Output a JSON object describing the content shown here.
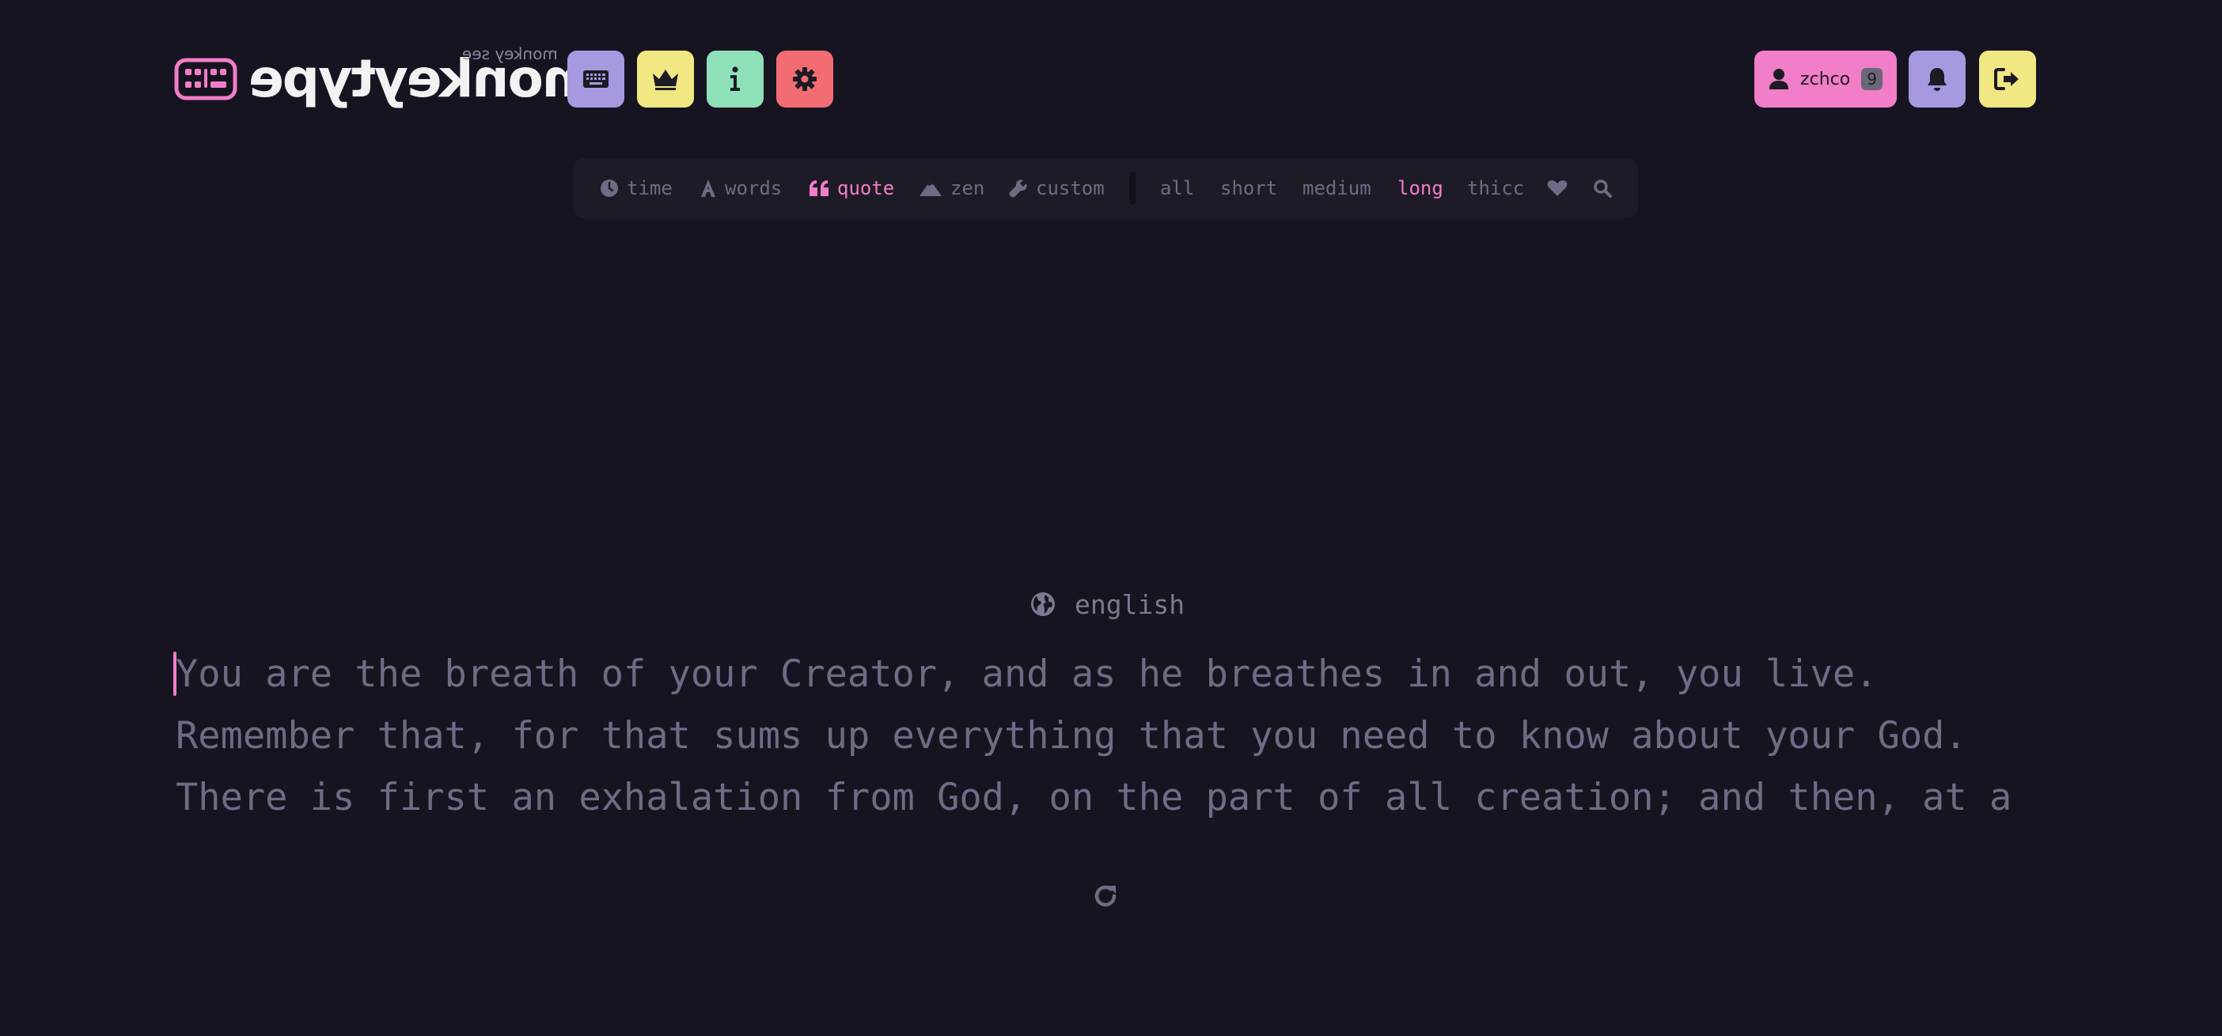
{
  "header": {
    "logo_text": "monkeytype",
    "logo_subtext": "monkey see",
    "nav_buttons": [
      {
        "name": "keyboard",
        "icon": "keyboard-icon",
        "color": "#a798e0"
      },
      {
        "name": "leaderboards",
        "icon": "crown-icon",
        "color": "#f1e783"
      },
      {
        "name": "about",
        "icon": "info-icon",
        "color": "#8ee0b9"
      },
      {
        "name": "settings",
        "icon": "gear-icon",
        "color": "#f26c73"
      }
    ],
    "account": {
      "username": "zchco",
      "level": "9",
      "icon": "user-icon",
      "color": "#f27dc8"
    },
    "notifications": {
      "icon": "bell-icon",
      "color": "#a798e0"
    },
    "logout": {
      "icon": "sign-out-icon",
      "color": "#f1e783"
    }
  },
  "config": {
    "modes": [
      {
        "label": "time",
        "icon": "clock-icon"
      },
      {
        "label": "words",
        "icon": "font-icon"
      },
      {
        "label": "quote",
        "icon": "quote-left-icon",
        "active": true
      },
      {
        "label": "zen",
        "icon": "mountain-icon"
      },
      {
        "label": "custom",
        "icon": "wrench-icon"
      }
    ],
    "quote_lengths": [
      {
        "label": "all"
      },
      {
        "label": "short"
      },
      {
        "label": "medium"
      },
      {
        "label": "long",
        "active": true
      },
      {
        "label": "thicc"
      }
    ],
    "favorite_icon": "heart-icon",
    "search_icon": "search-icon"
  },
  "test": {
    "language": "english",
    "caret_label": "zchco",
    "lines": [
      "You are the breath of your Creator, and as he breathes in and out, you live.",
      "Remember that, for that sums up everything that you need to know about your God.",
      "There is first an exhalation from God, on the part of all creation; and then, at a"
    ],
    "restart_icon": "redo-icon"
  },
  "colors": {
    "background": "#151420",
    "surface": "#1c1b26",
    "text_dim": "#6e6c85",
    "accent": "#f27dc8",
    "logo_text": "#f2f2f2"
  }
}
